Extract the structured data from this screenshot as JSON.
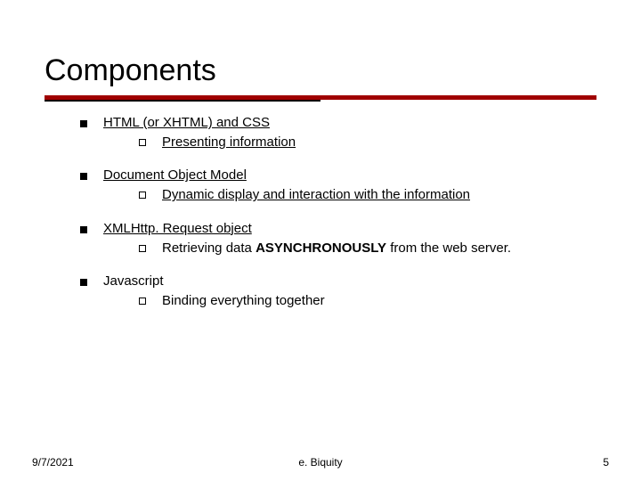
{
  "title": "Components",
  "bullets": [
    {
      "text": "HTML (or XHTML) and CSS",
      "underline": true,
      "sub": {
        "text": "Presenting information",
        "underline": true
      }
    },
    {
      "text": "Document Object Model",
      "underline": true,
      "sub": {
        "text": "Dynamic display and interaction with the information",
        "underline": true
      }
    },
    {
      "text": "XMLHttp. Request object",
      "underline": true,
      "sub": {
        "prefix": "Retrieving data ",
        "bold": "ASYNCHRONOUSLY",
        "suffix": " from the web server.",
        "underline": false
      }
    },
    {
      "text": "Javascript",
      "underline": false,
      "sub": {
        "text": "Binding everything together",
        "underline": false
      }
    }
  ],
  "footer": {
    "left": "9/7/2021",
    "center": "e. Biquity",
    "right": "5"
  }
}
